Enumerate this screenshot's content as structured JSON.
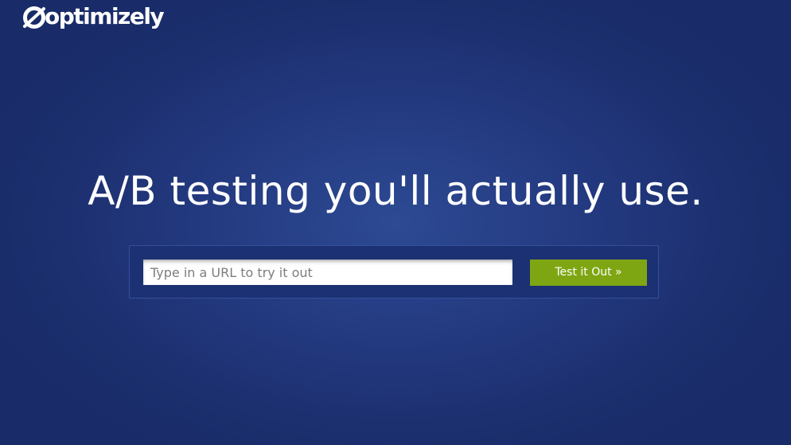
{
  "header": {
    "logo_text": "optimizely",
    "logo_icon": "optimizely-o-logo-icon"
  },
  "hero": {
    "headline": "A/B testing you'll actually use."
  },
  "search": {
    "placeholder": "Type in a URL to try it out",
    "value": "",
    "button_label": "Test it Out »"
  },
  "colors": {
    "background": "#23397f",
    "panel": "#1c3173",
    "button": "#7ea612",
    "text": "#ffffff"
  }
}
